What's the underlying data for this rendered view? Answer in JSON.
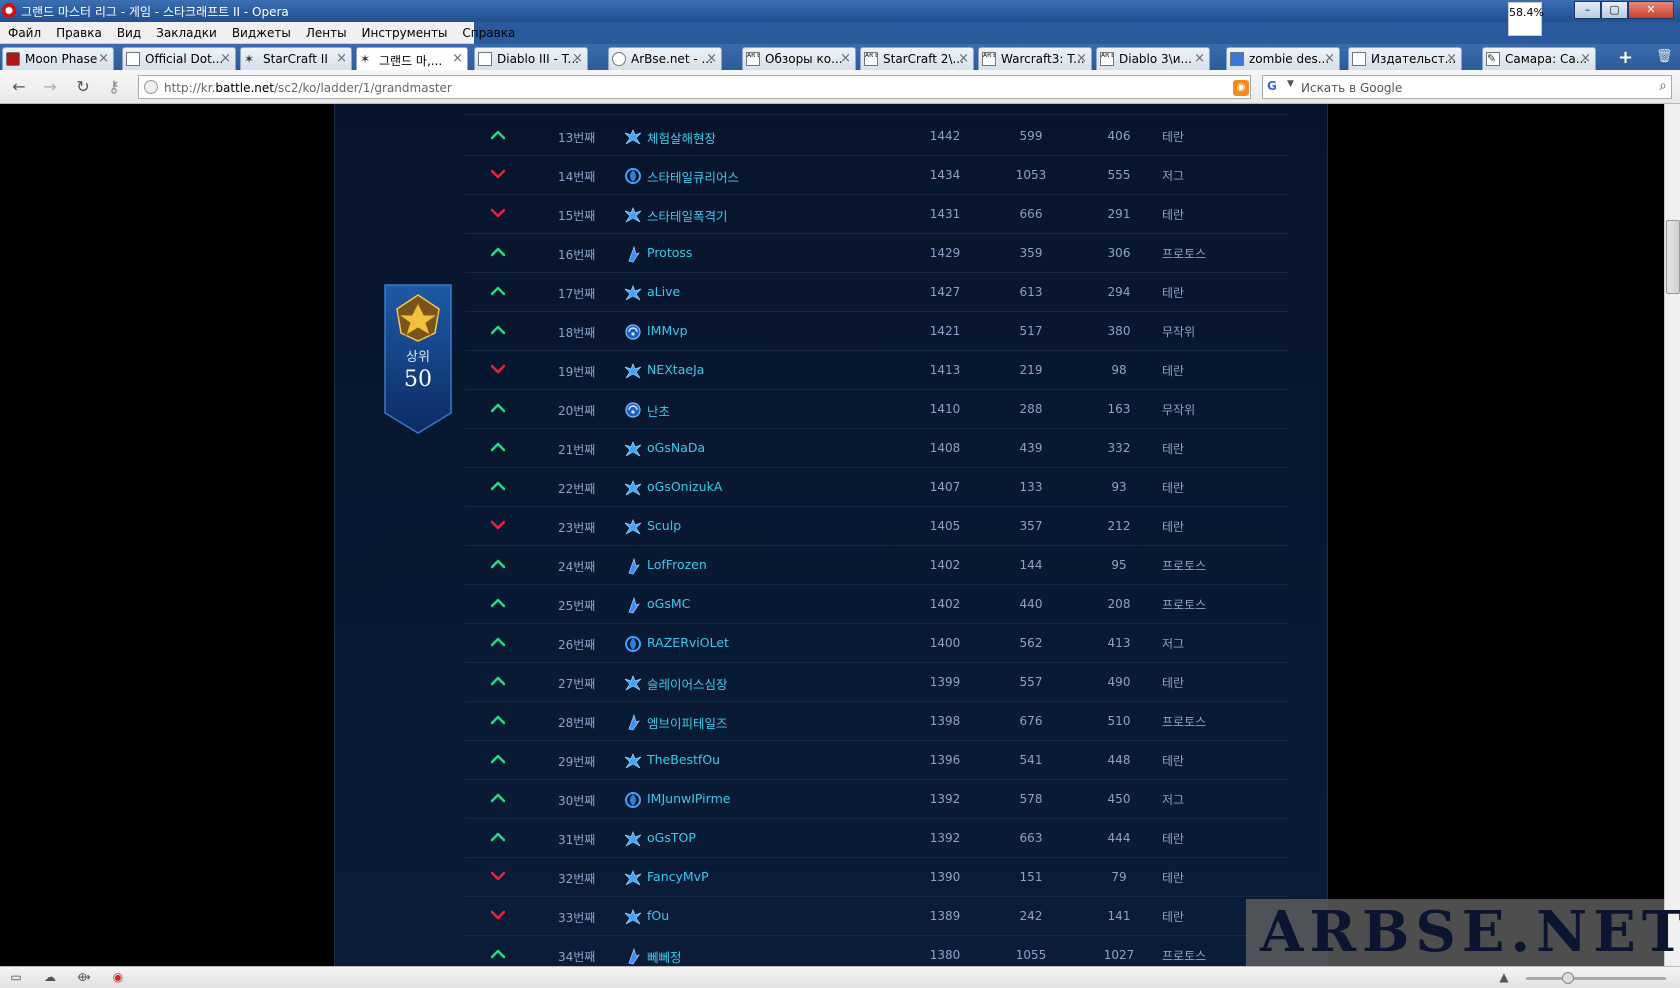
{
  "window": {
    "title": "그랜드 마스터 리그 - 게임 - 스타크래프트 II - Opera",
    "zoom_badge": "58.4%",
    "controls": {
      "minimize": "–",
      "maximize": "▢",
      "close": "✕"
    }
  },
  "menu": [
    "Файл",
    "Правка",
    "Вид",
    "Закладки",
    "Виджеты",
    "Ленты",
    "Инструменты",
    "Справка"
  ],
  "tabs": [
    {
      "label": "Moon Phase",
      "icon": "moon-phase-favicon",
      "active": false
    },
    {
      "label": "Official Dot...",
      "icon": "page-favicon",
      "active": false
    },
    {
      "label": "StarCraft II",
      "icon": "starcraft-favicon",
      "active": false
    },
    {
      "label": "그랜드 마,...",
      "icon": "starcraft-favicon",
      "active": true
    },
    {
      "label": "Diablo III - T...",
      "icon": "page-favicon",
      "active": false
    },
    {
      "label": "ArBse.net - ...",
      "icon": "arbse-favicon",
      "active": false
    },
    {
      "label": "Обзоры ко...",
      "icon": "arbse-favicon",
      "active": false
    },
    {
      "label": "StarCraft 2\\...",
      "icon": "arbse-favicon",
      "active": false
    },
    {
      "label": "Warcraft3: T...",
      "icon": "arbse-favicon",
      "active": false
    },
    {
      "label": "Diablo 3\\и...",
      "icon": "arbse-favicon",
      "active": false
    },
    {
      "label": "zombie des...",
      "icon": "zombie-favicon",
      "active": false
    },
    {
      "label": "Издательст...",
      "icon": "page-favicon",
      "active": false
    },
    {
      "label": "Самара: Са...",
      "icon": "edit-favicon",
      "active": false
    }
  ],
  "address": {
    "url_prefix": "http://kr.",
    "url_domain": "battle.net",
    "url_path": "/sc2/ko/ladder/1/grandmaster",
    "search_placeholder": "Искать в Google"
  },
  "badge": {
    "label": "상위",
    "value": "50"
  },
  "ladder": {
    "rows": [
      {
        "trend": "up",
        "rank": "13번째",
        "race_icon": "terran",
        "name": "체험살해현장",
        "points": "1442",
        "wins": "599",
        "losses": "406",
        "race": "테란"
      },
      {
        "trend": "down",
        "rank": "14번째",
        "race_icon": "zerg",
        "name": "스타테일큐리어스",
        "points": "1434",
        "wins": "1053",
        "losses": "555",
        "race": "저그"
      },
      {
        "trend": "down",
        "rank": "15번째",
        "race_icon": "terran",
        "name": "스타테일폭격기",
        "points": "1431",
        "wins": "666",
        "losses": "291",
        "race": "테란"
      },
      {
        "trend": "up",
        "rank": "16번째",
        "race_icon": "protoss",
        "name": "Protoss",
        "points": "1429",
        "wins": "359",
        "losses": "306",
        "race": "프로토스"
      },
      {
        "trend": "up",
        "rank": "17번째",
        "race_icon": "terran",
        "name": "aLive",
        "points": "1427",
        "wins": "613",
        "losses": "294",
        "race": "테란"
      },
      {
        "trend": "up",
        "rank": "18번째",
        "race_icon": "random",
        "name": "IMMvp",
        "points": "1421",
        "wins": "517",
        "losses": "380",
        "race": "무작위"
      },
      {
        "trend": "down",
        "rank": "19번째",
        "race_icon": "terran",
        "name": "NEXtaeJa",
        "points": "1413",
        "wins": "219",
        "losses": "98",
        "race": "테란"
      },
      {
        "trend": "up",
        "rank": "20번째",
        "race_icon": "random",
        "name": "난초",
        "points": "1410",
        "wins": "288",
        "losses": "163",
        "race": "무작위"
      },
      {
        "trend": "up",
        "rank": "21번째",
        "race_icon": "terran",
        "name": "oGsNaDa",
        "points": "1408",
        "wins": "439",
        "losses": "332",
        "race": "테란"
      },
      {
        "trend": "up",
        "rank": "22번째",
        "race_icon": "terran",
        "name": "oGsOnizukA",
        "points": "1407",
        "wins": "133",
        "losses": "93",
        "race": "테란"
      },
      {
        "trend": "down",
        "rank": "23번째",
        "race_icon": "terran",
        "name": "Sculp",
        "points": "1405",
        "wins": "357",
        "losses": "212",
        "race": "테란"
      },
      {
        "trend": "up",
        "rank": "24번째",
        "race_icon": "protoss",
        "name": "LofFrozen",
        "points": "1402",
        "wins": "144",
        "losses": "95",
        "race": "프로토스"
      },
      {
        "trend": "up",
        "rank": "25번째",
        "race_icon": "protoss",
        "name": "oGsMC",
        "points": "1402",
        "wins": "440",
        "losses": "208",
        "race": "프로토스"
      },
      {
        "trend": "up",
        "rank": "26번째",
        "race_icon": "zerg",
        "name": "RAZERviOLet",
        "points": "1400",
        "wins": "562",
        "losses": "413",
        "race": "저그"
      },
      {
        "trend": "up",
        "rank": "27번째",
        "race_icon": "terran",
        "name": "슬레이어스심장",
        "points": "1399",
        "wins": "557",
        "losses": "490",
        "race": "테란"
      },
      {
        "trend": "up",
        "rank": "28번째",
        "race_icon": "protoss",
        "name": "엠브이피테일즈",
        "points": "1398",
        "wins": "676",
        "losses": "510",
        "race": "프로토스"
      },
      {
        "trend": "up",
        "rank": "29번째",
        "race_icon": "terran",
        "name": "TheBestfOu",
        "points": "1396",
        "wins": "541",
        "losses": "448",
        "race": "테란"
      },
      {
        "trend": "up",
        "rank": "30번째",
        "race_icon": "zerg",
        "name": "IMJunwIPirme",
        "points": "1392",
        "wins": "578",
        "losses": "450",
        "race": "저그"
      },
      {
        "trend": "up",
        "rank": "31번째",
        "race_icon": "terran",
        "name": "oGsTOP",
        "points": "1392",
        "wins": "663",
        "losses": "444",
        "race": "테란"
      },
      {
        "trend": "down",
        "rank": "32번째",
        "race_icon": "terran",
        "name": "FancyMvP",
        "points": "1390",
        "wins": "151",
        "losses": "79",
        "race": "테란"
      },
      {
        "trend": "down",
        "rank": "33번째",
        "race_icon": "terran",
        "name": "fOu",
        "points": "1389",
        "wins": "242",
        "losses": "141",
        "race": "테란"
      },
      {
        "trend": "up",
        "rank": "34번째",
        "race_icon": "protoss",
        "name": "뻬뻬정",
        "points": "1380",
        "wins": "1055",
        "losses": "1027",
        "race": "프로토스"
      }
    ]
  },
  "watermark": "ARBSE.NET",
  "colors": {
    "up": "#28d87a",
    "down": "#e8233a",
    "name": "#3ec8e8",
    "text": "#8ba3c7",
    "page_bg": "#0a1c38"
  }
}
